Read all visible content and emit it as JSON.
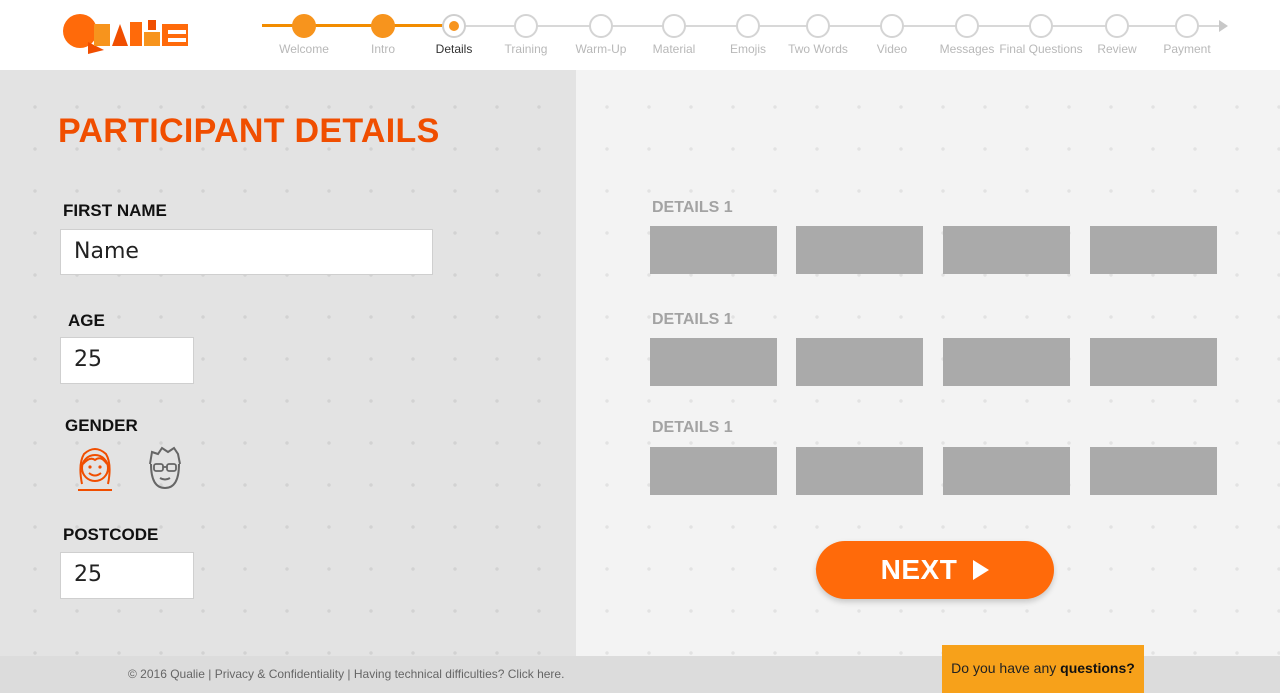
{
  "brand": {
    "logo_text": "QUALIE",
    "accent": "#f04e00",
    "progress_color": "#f7941d",
    "button_color": "#ff6a0a"
  },
  "progress": {
    "steps": [
      {
        "label": "Welcome",
        "state": "done"
      },
      {
        "label": "Intro",
        "state": "done"
      },
      {
        "label": "Details",
        "state": "current"
      },
      {
        "label": "Training",
        "state": "todo"
      },
      {
        "label": "Warm-Up",
        "state": "todo"
      },
      {
        "label": "Material",
        "state": "todo"
      },
      {
        "label": "Emojis",
        "state": "todo"
      },
      {
        "label": "Two Words",
        "state": "todo"
      },
      {
        "label": "Video",
        "state": "todo"
      },
      {
        "label": "Messages",
        "state": "todo"
      },
      {
        "label": "Final Questions",
        "state": "todo"
      },
      {
        "label": "Review",
        "state": "todo"
      },
      {
        "label": "Payment",
        "state": "todo"
      }
    ]
  },
  "form": {
    "title": "PARTICIPANT DETAILS",
    "first_name": {
      "label": "FIRST NAME",
      "value": "Name"
    },
    "age": {
      "label": "AGE",
      "value": "25"
    },
    "gender": {
      "label": "GENDER",
      "options": [
        {
          "icon": "female-face-icon",
          "selected": true
        },
        {
          "icon": "male-face-icon",
          "selected": false
        }
      ]
    },
    "postcode": {
      "label": "POSTCODE",
      "value": "25"
    }
  },
  "details": {
    "groups": [
      {
        "label": "DETAILS 1",
        "swatches": 4
      },
      {
        "label": "DETAILS 1",
        "swatches": 4
      },
      {
        "label": "DETAILS 1",
        "swatches": 4
      }
    ],
    "swatch_color": "#aaaaaa"
  },
  "next_button": {
    "label": "NEXT"
  },
  "footer": {
    "copyright": "© 2016 Qualie",
    "privacy": "Privacy & Confidentiality",
    "help": "Having technical difficulties? Click here."
  },
  "questions": {
    "prefix": "Do you have any ",
    "strong": "questions?"
  }
}
